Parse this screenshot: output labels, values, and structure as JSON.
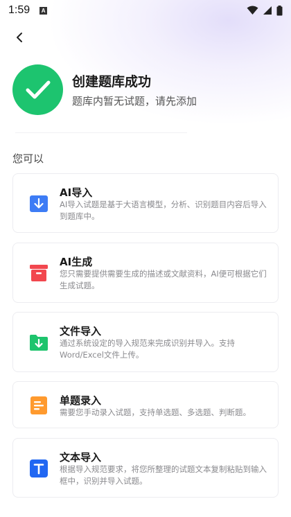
{
  "status_bar": {
    "time": "1:59",
    "notification_badge": "A"
  },
  "header": {
    "back_icon": "chevron-left-icon"
  },
  "success": {
    "icon": "checkmark-icon",
    "color": "#1dc46f",
    "title": "创建题库成功",
    "subtitle": "题库内暂无试题，请先添加"
  },
  "section_label": "您可以",
  "options": [
    {
      "id": "ai-import",
      "icon": "ai-import-icon",
      "icon_color": "#3d7cf5",
      "title": "AI导入",
      "desc": "AI导入试题是基于大语言模型，分析、识别题目内容后导入到题库中。"
    },
    {
      "id": "ai-generate",
      "icon": "ai-generate-icon",
      "icon_color": "#f2474e",
      "title": "AI生成",
      "desc": "您只需要提供需要生成的描述或文献资料，AI便可根据它们生成试题。"
    },
    {
      "id": "file-import",
      "icon": "file-import-icon",
      "icon_color": "#1ec46d",
      "title": "文件导入",
      "desc": "通过系统设定的导入规范来完成识别并导入。支持Word/Excel文件上传。"
    },
    {
      "id": "single-entry",
      "icon": "single-entry-icon",
      "icon_color": "#ff9a2e",
      "title": "单题录入",
      "desc": "需要您手动录入试题，支持单选题、多选题、判断题。"
    },
    {
      "id": "text-import",
      "icon": "text-import-icon",
      "icon_color": "#2167f2",
      "title": "文本导入",
      "desc": "根据导入规范要求，将您所整理的试题文本复制粘贴到输入框中，识别并导入试题。"
    }
  ]
}
